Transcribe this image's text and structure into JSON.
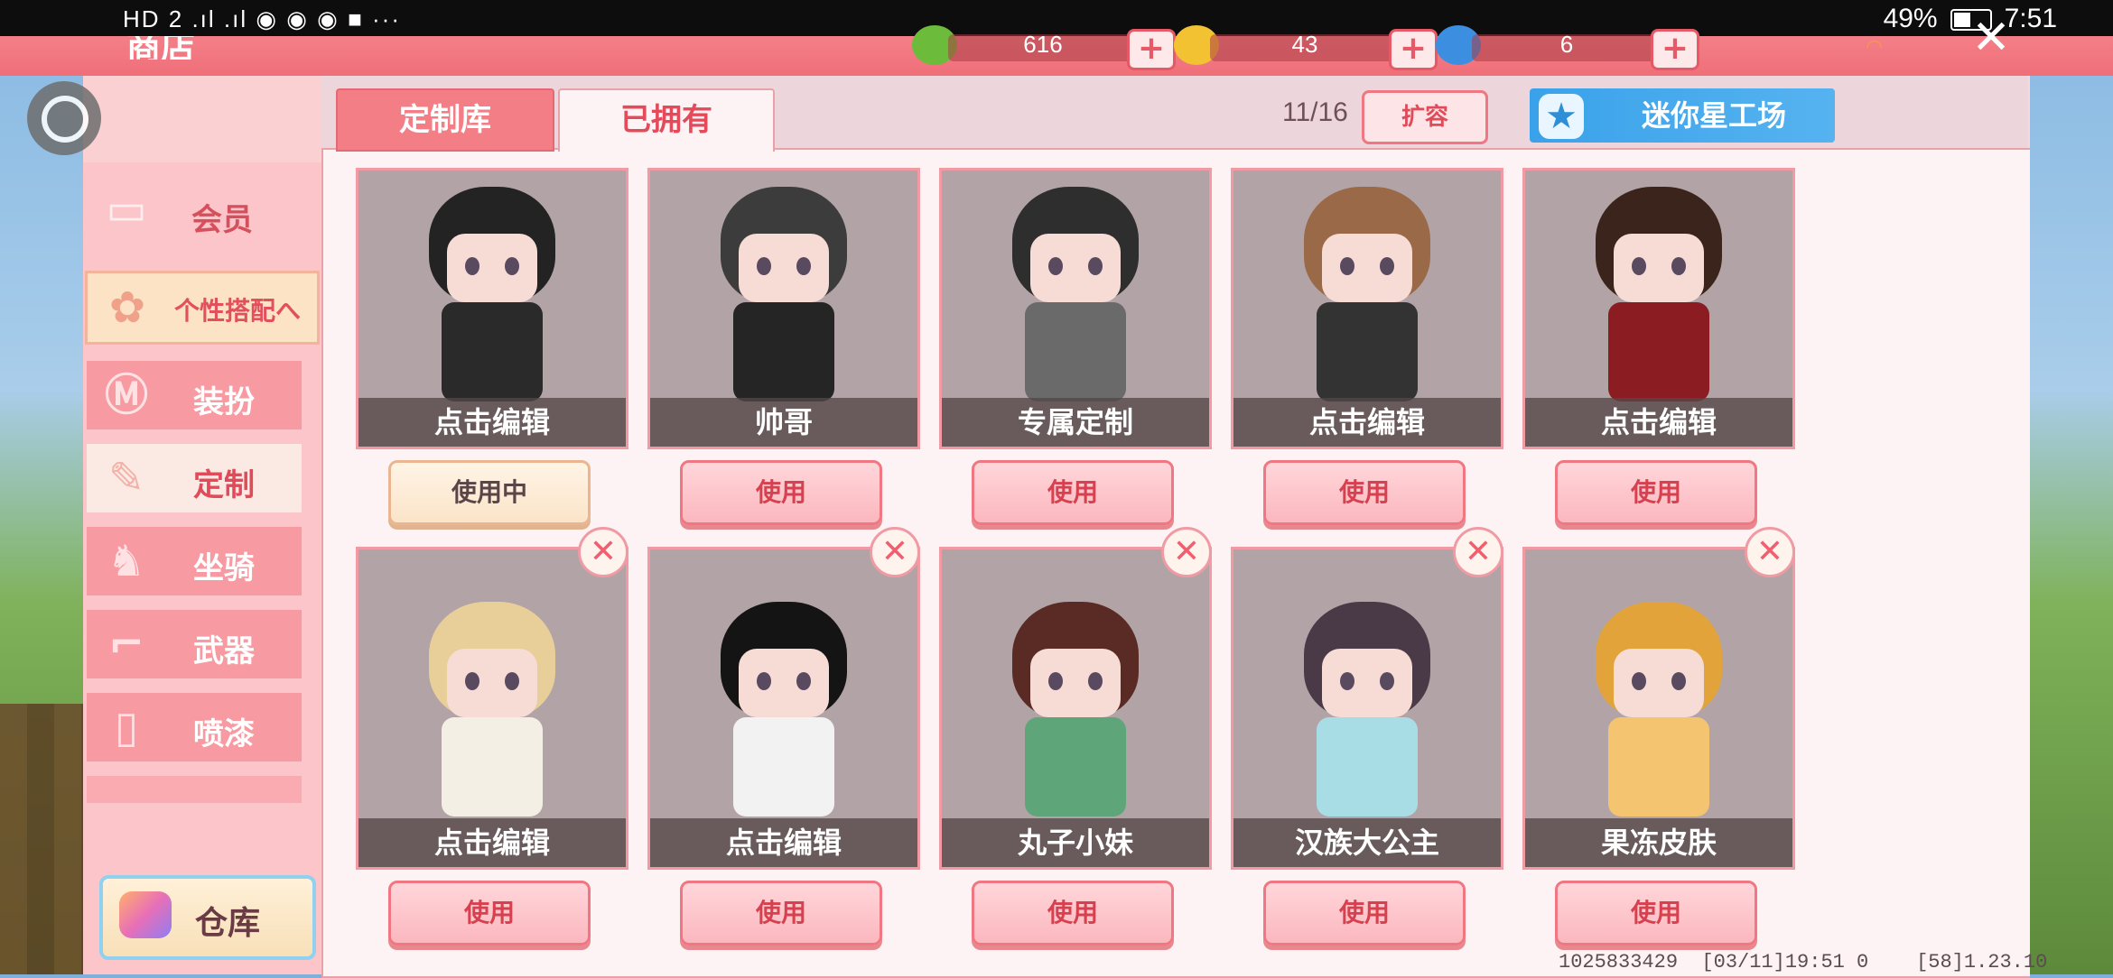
{
  "status_bar": {
    "left": "HD 2 .ıl .ıl ◉ ◉ ◉ ■ ···",
    "battery": "49%",
    "time": "7:51"
  },
  "header": {
    "title": "商店",
    "currencies": [
      {
        "name": "green-gem",
        "value": "616",
        "color": "#6dbb3a"
      },
      {
        "name": "gold-coin",
        "value": "43",
        "color": "#f2c232"
      },
      {
        "name": "blue-gem",
        "value": "6",
        "color": "#3b8ee0"
      }
    ]
  },
  "tabs": {
    "custom_library": "定制库",
    "owned": "已拥有",
    "slot_count": "11/16",
    "expand": "扩容",
    "workshop": "迷你星工场"
  },
  "sidebar": {
    "member": "会员",
    "personal_outfit": "个性搭配へ",
    "dress_up": "装扮",
    "customize": "定制",
    "mount": "坐骑",
    "weapon": "武器",
    "spray": "喷漆",
    "warehouse": "仓库"
  },
  "cards": [
    {
      "name": "点击编辑",
      "button": "使用中",
      "hair": "#232323",
      "outfit": "#2a2a2a"
    },
    {
      "name": "帅哥",
      "button": "使用",
      "hair": "#3c3c3c",
      "outfit": "#252525"
    },
    {
      "name": "专属定制",
      "button": "使用",
      "hair": "#2e2e2e",
      "outfit": "#6a6a6a"
    },
    {
      "name": "点击编辑",
      "button": "使用",
      "hair": "#9a6a48",
      "outfit": "#333"
    },
    {
      "name": "点击编辑",
      "button": "使用",
      "hair": "#3a241c",
      "outfit": "#8b1d22"
    },
    {
      "name": "点击编辑",
      "button": "使用",
      "hair": "#e8cf9a",
      "outfit": "#f3efe5"
    },
    {
      "name": "点击编辑",
      "button": "使用",
      "hair": "#141414",
      "outfit": "#f2f2f2"
    },
    {
      "name": "丸子小妹",
      "button": "使用",
      "hair": "#5a2b24",
      "outfit": "#5fa57a"
    },
    {
      "name": "汉族大公主",
      "button": "使用",
      "hair": "#4a3a48",
      "outfit": "#a9dde6"
    },
    {
      "name": "果冻皮肤",
      "button": "使用",
      "hair": "#e2a43a",
      "outfit": "#f5c470"
    }
  ],
  "footer": {
    "info": "1025833429  [03/11]19:51 0    [58]1.23.10"
  }
}
